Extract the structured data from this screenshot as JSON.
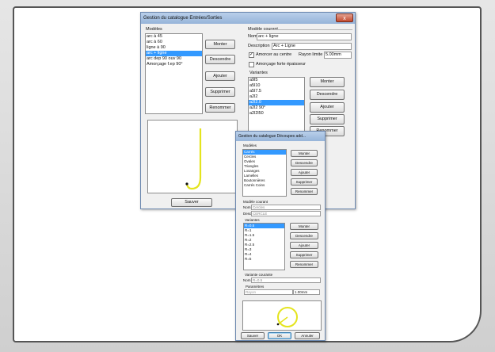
{
  "win1": {
    "title": "Gestion du catalogue Entrées/Sorties",
    "close": "x",
    "models_label": "Modèles",
    "models": [
      "arc à 45",
      "arc à 60",
      "ligne à 90",
      "arc + ligne",
      "arc dep 90 ouv 90",
      "Amorçage f.ep 90°"
    ],
    "models_selected": 3,
    "btn_monter": "Monter",
    "btn_descendre": "Descendre",
    "btn_ajouter": "Ajouter",
    "btn_supprimer": "Supprimer",
    "btn_renommer": "Renommer",
    "btn_sauver": "Sauver",
    "current_model_label": "Modèle courant",
    "nom_label": "Nom",
    "nom_value": "arc + ligne",
    "description_label": "Description",
    "description_value": "Arc + Ligne",
    "amorcer_label": "Amorcer au centre",
    "amorcer_checked": "✓",
    "rayon_label": "Rayon limite",
    "rayon_value": "5.00mm",
    "amorcage_label": "Amorçage forte épaisseur",
    "variantes_label": "Variantes",
    "variants": [
      "a9l5",
      "a5l10",
      "a5l7.5",
      "a2l2",
      "a2l2.0",
      "a2l2 90°",
      "a2l2l50"
    ],
    "variants_selected": 4,
    "btn_v_monter": "Monter",
    "btn_v_descendre": "Descendre",
    "btn_v_ajouter": "Ajouter",
    "btn_v_supprimer": "Supprimer",
    "btn_v_renommer": "Renommer"
  },
  "win2": {
    "title": "Gestion du catalogue Découpes add...",
    "close": "x",
    "models_label": "Modèles",
    "models": [
      "Carrés",
      "Cercles",
      "Ovales",
      "Triangles",
      "Losanges",
      "Lamelles",
      "Boutonnières",
      "Carrés Coins"
    ],
    "models_selected": 0,
    "btn_monter": "Monter",
    "btn_descendre": "Descendre",
    "btn_ajouter": "Ajouter",
    "btn_supprimer": "Supprimer",
    "btn_renommer": "Renommer",
    "current_model_label": "Modèle courant",
    "nom_label": "Nom",
    "nom_value": "Cercles",
    "desc_label": "Desc",
    "desc_value": "CERCLE",
    "variantes_label": "Variantes",
    "variants": [
      "R=0.5",
      "R=1",
      "R=1.5",
      "R=2",
      "R=2.5",
      "R=3",
      "R=4",
      "R=5"
    ],
    "variants_selected": 0,
    "btn_v_monter": "Monter",
    "btn_v_descendre": "Descendre",
    "btn_v_ajouter": "Ajouter",
    "btn_v_supprimer": "Supprimer",
    "btn_v_renommer": "Renommer",
    "current_variant_label": "Variante courante",
    "vnom_label": "Nom",
    "vnom_value": "R=0.5",
    "parametres_label": "Paramètres",
    "param_name": "Rayon",
    "param_value": "1.00mm",
    "btn_sauver": "Sauver",
    "btn_ok": "OK",
    "btn_annuler": "Annuler"
  },
  "colors": {
    "selection": "#3399ff",
    "preview_stroke": "#e4e41e"
  }
}
